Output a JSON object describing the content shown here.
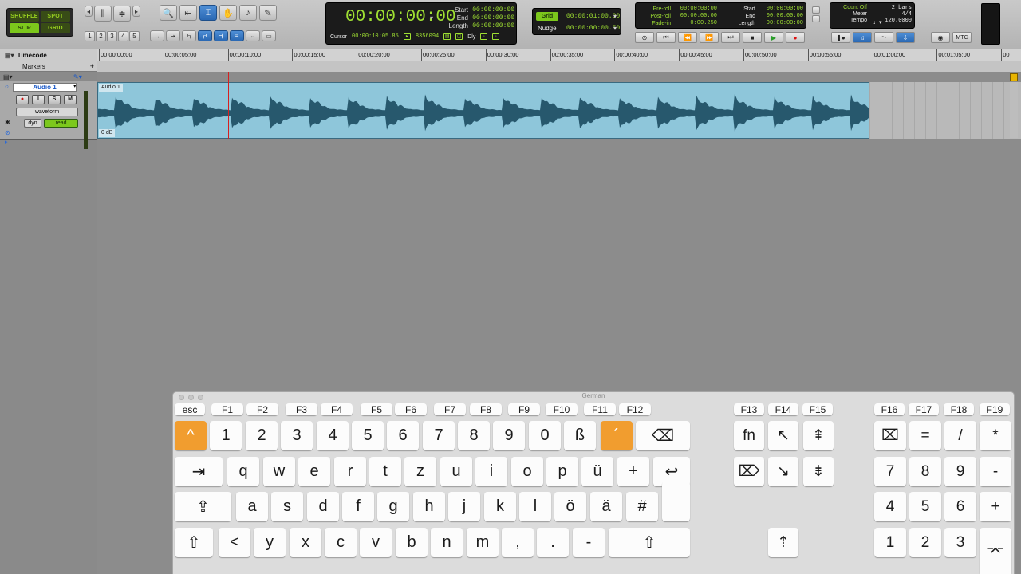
{
  "toolbar": {
    "edit_modes": [
      "SHUFFLE",
      "SPOT",
      "SLIP",
      "GRID"
    ],
    "zoom_presets": [
      "1",
      "2",
      "3",
      "4",
      "5"
    ],
    "counter": {
      "main": "00:00:00:00",
      "start_label": "Start",
      "end_label": "End",
      "length_label": "Length",
      "start": "00:00:00:00",
      "end": "00:00:00:00",
      "length": "00:00:00:00",
      "cursor_label": "Cursor",
      "cursor_value": "00:00:10:05.85",
      "samples": "8356094",
      "dly_label": "Dly"
    },
    "grid": {
      "label": "Grid",
      "value": "00:00:01:00.00",
      "nudge_label": "Nudge",
      "nudge_value": "00:00:00:00.50"
    },
    "transport": {
      "preroll_label": "Pre-roll",
      "postroll_label": "Post-roll",
      "fadein_label": "Fade-in",
      "preroll": "00:00:00:00",
      "postroll": "00:00:00:00",
      "fadein": "0:00.250",
      "start_label": "Start",
      "end_label": "End",
      "length_label": "Length",
      "start": "00:00:00:00",
      "end": "00:00:00:00",
      "length": "00:00:00:00"
    },
    "meter": {
      "countoff_label": "Count Off",
      "countoff": "2 bars",
      "meter_label": "Meter",
      "meter": "4/4",
      "tempo_label": "Tempo",
      "tempo": "120.0000"
    },
    "mtc_label": "MTC"
  },
  "rulers": {
    "timecode_label": "Timecode",
    "markers_label": "Markers",
    "ticks": [
      "00:00:00:00",
      "00:00:05:00",
      "00:00:10:00",
      "00:00:15:00",
      "00:00:20:00",
      "00:00:25:00",
      "00:00:30:00",
      "00:00:35:00",
      "00:00:40:00",
      "00:00:45:00",
      "00:00:50:00",
      "00:00:55:00",
      "00:01:00:00",
      "00:01:05:00",
      "00"
    ]
  },
  "track": {
    "name": "Audio 1",
    "buttons": [
      "●",
      "I",
      "S",
      "M"
    ],
    "view": "waveform",
    "auto_dyn": "dyn",
    "auto_mode": "read"
  },
  "clip": {
    "name": "Audio 1",
    "gain": "0 dB"
  },
  "keyboard": {
    "title": "German",
    "fn_row": [
      "esc",
      "F1",
      "F2",
      "F3",
      "F4",
      "F5",
      "F6",
      "F7",
      "F8",
      "F9",
      "F10",
      "F11",
      "F12",
      "F13",
      "F14",
      "F15",
      "F16",
      "F17",
      "F18",
      "F19"
    ],
    "row1": [
      "^",
      "1",
      "2",
      "3",
      "4",
      "5",
      "6",
      "7",
      "8",
      "9",
      "0",
      "ß",
      "´",
      "⌫"
    ],
    "row2": [
      "⇥",
      "q",
      "w",
      "e",
      "r",
      "t",
      "z",
      "u",
      "i",
      "o",
      "p",
      "ü",
      "+",
      "↩"
    ],
    "row3": [
      "⇪",
      "a",
      "s",
      "d",
      "f",
      "g",
      "h",
      "j",
      "k",
      "l",
      "ö",
      "ä",
      "#"
    ],
    "row4": [
      "⇧",
      "<",
      "y",
      "x",
      "c",
      "v",
      "b",
      "n",
      "m",
      ",",
      ".",
      "-",
      "⇧"
    ],
    "nav": [
      "fn",
      "↖",
      "⇞",
      "⌦",
      "↘",
      "⇟",
      "⇡"
    ],
    "numpad": [
      "⌧",
      "=",
      "/",
      "*",
      "7",
      "8",
      "9",
      "-",
      "4",
      "5",
      "6",
      "+",
      "1",
      "2",
      "3",
      "⌤"
    ]
  }
}
